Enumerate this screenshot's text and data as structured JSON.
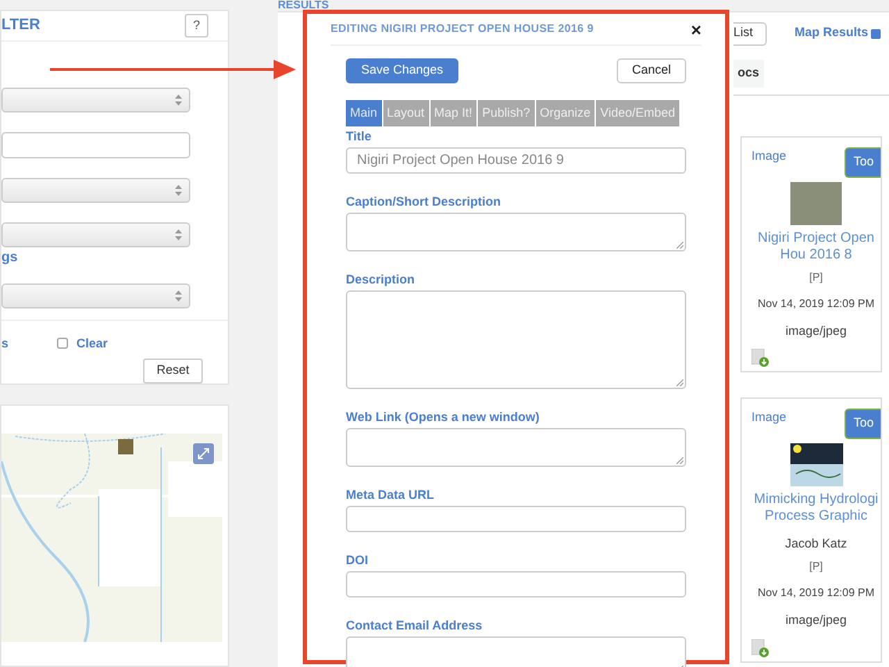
{
  "filter": {
    "title": "LTER",
    "help_button": "?",
    "fields": [
      {
        "kind": "select"
      },
      {
        "kind": "input"
      },
      {
        "kind": "select"
      },
      {
        "kind": "select"
      },
      {
        "kind": "label",
        "text": "gs"
      },
      {
        "kind": "select"
      }
    ],
    "options": [
      {
        "kind": "text",
        "label": "s"
      },
      {
        "kind": "checkbox",
        "label": "Clear",
        "checked": false
      }
    ],
    "reset_button": "Reset"
  },
  "results": {
    "title": "RESULTS",
    "list_button": "List",
    "map_results": {
      "label": "Map Results",
      "checked": true
    },
    "tab": "ocs",
    "cards": [
      {
        "type": "Image",
        "tools_button": "Too",
        "title": "Nigiri Project Open Hou 2016 8",
        "flag": "[P]",
        "date": "Nov 14, 2019 12:09 PM",
        "mime": "image/jpeg",
        "kind": "photo"
      },
      {
        "type": "Image",
        "tools_button": "Too",
        "title": "Mimicking Hydrologi Process Graphic",
        "author": "Jacob Katz",
        "flag": "[P]",
        "date": "Nov 14, 2019 12:09 PM",
        "mime": "image/jpeg",
        "kind": "graphic"
      }
    ]
  },
  "modal": {
    "title": "EDITING NIGIRI PROJECT OPEN HOUSE 2016 9",
    "close": "×",
    "save_button": "Save Changes",
    "cancel_button": "Cancel",
    "tabs": [
      {
        "label": "Main",
        "selected": true
      },
      {
        "label": "Layout",
        "selected": false
      },
      {
        "label": "Map It!",
        "selected": false
      },
      {
        "label": "Publish?",
        "selected": false
      },
      {
        "label": "Organize",
        "selected": false
      },
      {
        "label": "Video/Embed",
        "selected": false
      }
    ],
    "fields": [
      {
        "label": "Title",
        "kind": "input",
        "value": "Nigiri Project Open House 2016 9"
      },
      {
        "label": "Caption/Short Description",
        "kind": "textarea"
      },
      {
        "label": "Description",
        "kind": "tall"
      },
      {
        "label": "Web Link (Opens a new window)",
        "kind": "textarea"
      },
      {
        "label": "Meta Data URL",
        "kind": "input"
      },
      {
        "label": "DOI",
        "kind": "input"
      },
      {
        "label": "Contact Email Address",
        "kind": "textarea"
      }
    ]
  }
}
